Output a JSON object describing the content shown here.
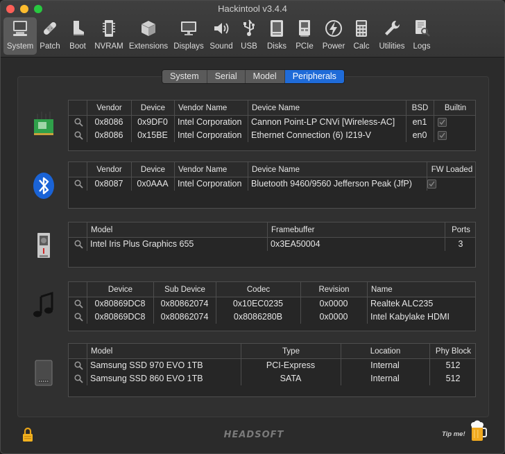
{
  "window": {
    "title": "Hackintool v3.4.4"
  },
  "toolbar": {
    "items": [
      {
        "label": "System",
        "icon": "computer-icon",
        "active": true
      },
      {
        "label": "Patch",
        "icon": "bandage-icon"
      },
      {
        "label": "Boot",
        "icon": "boot-icon"
      },
      {
        "label": "NVRAM",
        "icon": "memory-chip-icon"
      },
      {
        "label": "Extensions",
        "icon": "cube-icon"
      },
      {
        "label": "Displays",
        "icon": "monitor-icon"
      },
      {
        "label": "Sound",
        "icon": "speaker-icon"
      },
      {
        "label": "USB",
        "icon": "usb-icon"
      },
      {
        "label": "Disks",
        "icon": "disk-icon"
      },
      {
        "label": "PCIe",
        "icon": "pcie-card-icon"
      },
      {
        "label": "Power",
        "icon": "lightning-icon"
      },
      {
        "label": "Calc",
        "icon": "calculator-icon"
      },
      {
        "label": "Utilities",
        "icon": "wrench-icon"
      },
      {
        "label": "Logs",
        "icon": "log-magnifier-icon"
      }
    ]
  },
  "tabs": [
    "System",
    "Serial",
    "Model",
    "Peripherals"
  ],
  "active_tab": "Peripherals",
  "network": {
    "headers": [
      "Vendor",
      "Device",
      "Vendor Name",
      "Device Name",
      "BSD",
      "Builtin"
    ],
    "rows": [
      {
        "vendor": "0x8086",
        "device": "0x9DF0",
        "vendor_name": "Intel Corporation",
        "device_name": "Cannon Point-LP CNVi [Wireless-AC]",
        "bsd": "en1",
        "builtin": true
      },
      {
        "vendor": "0x8086",
        "device": "0x15BE",
        "vendor_name": "Intel Corporation",
        "device_name": "Ethernet Connection (6) I219-V",
        "bsd": "en0",
        "builtin": true
      }
    ]
  },
  "bluetooth": {
    "headers": [
      "Vendor",
      "Device",
      "Vendor Name",
      "Device Name",
      "FW Loaded"
    ],
    "rows": [
      {
        "vendor": "0x8087",
        "device": "0x0AAA",
        "vendor_name": "Intel Corporation",
        "device_name": "Bluetooth 9460/9560 Jefferson Peak (JfP)",
        "fw_loaded": true
      }
    ]
  },
  "graphics": {
    "headers": [
      "Model",
      "Framebuffer",
      "Ports"
    ],
    "rows": [
      {
        "model": "Intel Iris Plus Graphics 655",
        "framebuffer": "0x3EA50004",
        "ports": "3"
      }
    ]
  },
  "audio": {
    "headers": [
      "Device",
      "Sub Device",
      "Codec",
      "Revision",
      "Name"
    ],
    "rows": [
      {
        "device": "0x80869DC8",
        "sub_device": "0x80862074",
        "codec": "0x10EC0235",
        "revision": "0x0000",
        "name": "Realtek ALC235"
      },
      {
        "device": "0x80869DC8",
        "sub_device": "0x80862074",
        "codec": "0x8086280B",
        "revision": "0x0000",
        "name": "Intel Kabylake HDMI"
      }
    ]
  },
  "storage": {
    "headers": [
      "Model",
      "Type",
      "Location",
      "Phy Block"
    ],
    "rows": [
      {
        "model": "Samsung SSD 970 EVO 1TB",
        "type": "PCI-Express",
        "location": "Internal",
        "phy_block": "512"
      },
      {
        "model": "Samsung SSD 860 EVO 1TB",
        "type": "SATA",
        "location": "Internal",
        "phy_block": "512"
      }
    ]
  },
  "footer": {
    "brand": "HEADSOFT",
    "tip": "Tip me!"
  },
  "colors": {
    "accent": "#1f6bd8",
    "background": "#2d2d2d"
  }
}
